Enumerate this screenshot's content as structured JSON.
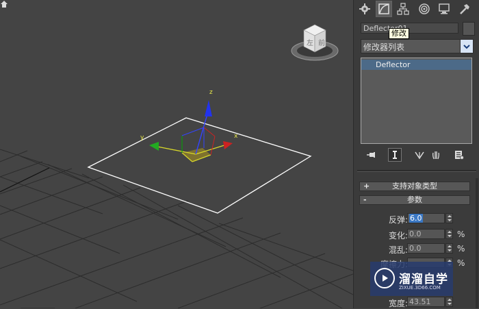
{
  "viewport": {
    "viewcube": {
      "face_left": "左",
      "face_front": "前"
    },
    "axis_labels": {
      "x": "x",
      "y": "y",
      "z": "z"
    }
  },
  "panel": {
    "tabs": [
      {
        "name": "create",
        "icon": "create-tab-icon"
      },
      {
        "name": "modify",
        "icon": "modify-tab-icon",
        "active": true
      },
      {
        "name": "hierarchy",
        "icon": "hierarchy-tab-icon"
      },
      {
        "name": "motion",
        "icon": "motion-tab-icon"
      },
      {
        "name": "display",
        "icon": "display-tab-icon"
      },
      {
        "name": "utilities",
        "icon": "utilities-tab-icon"
      }
    ],
    "object_name": "Deflector01",
    "tooltip": "修改",
    "modifier_list_label": "修改器列表",
    "stack_items": [
      "Deflector"
    ],
    "rollouts": {
      "supported": {
        "sign": "+",
        "title": "支持对象类型"
      },
      "params": {
        "sign": "-",
        "title": "参数"
      }
    },
    "params": [
      {
        "label": "反弹:",
        "value": "6.0",
        "unit": ""
      },
      {
        "label": "变化:",
        "value": "0.0",
        "unit": "%"
      },
      {
        "label": "混乱:",
        "value": "0.0",
        "unit": "%"
      },
      {
        "label": "摩擦力:",
        "value": "",
        "unit": "%"
      },
      {
        "label": "宽度:",
        "value": "43.51",
        "unit": ""
      }
    ]
  },
  "watermark": {
    "title": "溜溜自学",
    "sub": "ZIXUE.3D66.COM"
  },
  "colors": {
    "viewport_bg": "#444444",
    "panel_bg": "#3b3b3b",
    "selection_white": "#ffffff",
    "axis_x": "#ff0000",
    "axis_y": "#00aa00",
    "axis_z": "#0000ff",
    "highlight_yellow": "#d8d82a"
  }
}
